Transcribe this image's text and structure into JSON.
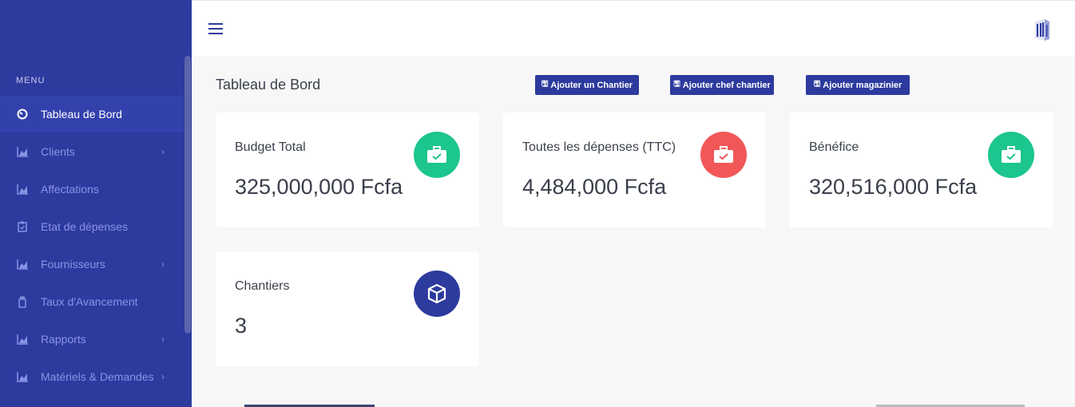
{
  "sidebar": {
    "menu_title": "MENU",
    "items": [
      {
        "label": "Tableau de Bord",
        "icon": "dashboard-icon",
        "active": true
      },
      {
        "label": "Clients",
        "icon": "chart-icon",
        "has_submenu": true
      },
      {
        "label": "Affectations",
        "icon": "chart-icon"
      },
      {
        "label": "Etat de dépenses",
        "icon": "clipboard-icon"
      },
      {
        "label": "Fournisseurs",
        "icon": "chart-icon",
        "has_submenu": true
      },
      {
        "label": "Taux d'Avancement",
        "icon": "jar-icon"
      },
      {
        "label": "Rapports",
        "icon": "chart-icon",
        "has_submenu": true
      },
      {
        "label": "Matériels & Demandes",
        "icon": "chart-icon",
        "has_submenu": true
      }
    ]
  },
  "page": {
    "title": "Tableau de Bord",
    "buttons": [
      {
        "label": "Ajouter un Chantier"
      },
      {
        "label": "Ajouter chef chantier"
      },
      {
        "label": "Ajouter magazinier"
      }
    ]
  },
  "cards": [
    {
      "label": "Budget Total",
      "value": "325,000,000 Fcfa",
      "icon": "briefcase-check-icon",
      "color": "#1dc58f"
    },
    {
      "label": "Toutes les dépenses (TTC)",
      "value": "4,484,000 Fcfa",
      "icon": "briefcase-check-icon",
      "color": "#f25757"
    },
    {
      "label": "Bénéfice",
      "value": "320,516,000 Fcfa",
      "icon": "briefcase-check-icon",
      "color": "#1dc58f"
    },
    {
      "label": "Chantiers",
      "value": "3",
      "icon": "cube-icon",
      "color": "#2d3a9e"
    }
  ],
  "colors": {
    "sidebar": "#2d3a9e",
    "accent": "#2d3a9e",
    "success": "#1dc58f",
    "danger": "#f25757"
  }
}
